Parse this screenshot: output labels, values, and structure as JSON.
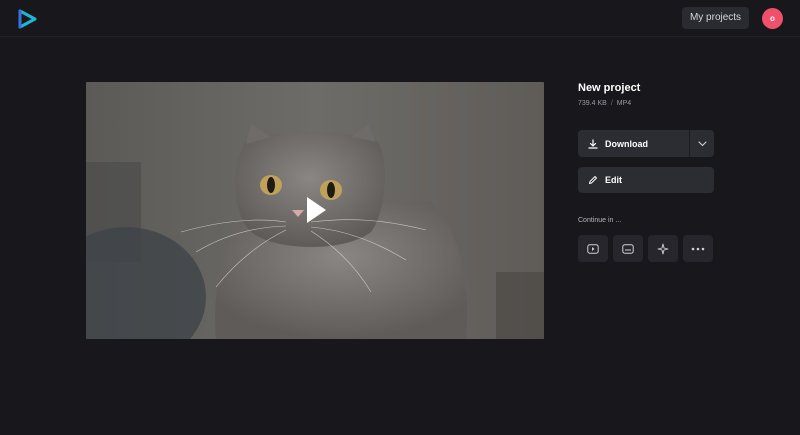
{
  "header": {
    "logo_icon": "play-logo-icon",
    "my_projects_label": "My projects",
    "avatar_initial": "o",
    "avatar_color": "#f0506a"
  },
  "player": {
    "play_icon": "play-icon"
  },
  "project": {
    "title": "New project",
    "size": "739.4 KB",
    "format": "MP4"
  },
  "actions": {
    "download_label": "Download",
    "edit_label": "Edit"
  },
  "continue": {
    "label": "Continue in ...",
    "items": [
      {
        "icon": "youtube-icon"
      },
      {
        "icon": "subtitles-icon"
      },
      {
        "icon": "sparkle-icon"
      },
      {
        "icon": "more-icon"
      }
    ]
  },
  "colors": {
    "background": "#18181c",
    "button": "#2c2c33",
    "accent": "#1fb5d6"
  }
}
